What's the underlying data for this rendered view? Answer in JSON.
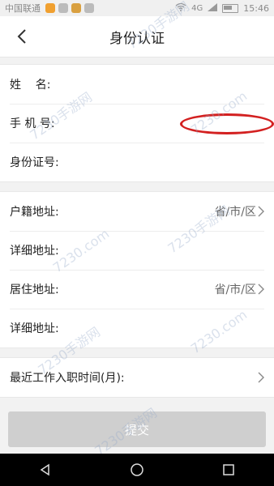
{
  "status_bar": {
    "carrier": "中国联通",
    "network": "4G",
    "time": "15:46"
  },
  "header": {
    "title": "身份认证",
    "back_icon": "chevron-left-icon"
  },
  "personal_info": {
    "name_label": "姓    名:",
    "phone_label": "手 机 号:",
    "id_label": "身份证号:"
  },
  "address": {
    "household_label": "户籍地址:",
    "household_value": "省/市/区",
    "household_detail_label": "详细地址:",
    "residence_label": "居住地址:",
    "residence_value": "省/市/区",
    "residence_detail_label": "详细地址:"
  },
  "employment": {
    "hire_time_label": "最近工作入职时间(月):"
  },
  "submit_label": "提交",
  "watermark_text": "7230手游网",
  "watermark_url": "7230.com",
  "colors": {
    "background": "#f2f2f2",
    "card": "#ffffff",
    "button_disabled": "#cfcfcf",
    "annotation": "#d32020"
  }
}
